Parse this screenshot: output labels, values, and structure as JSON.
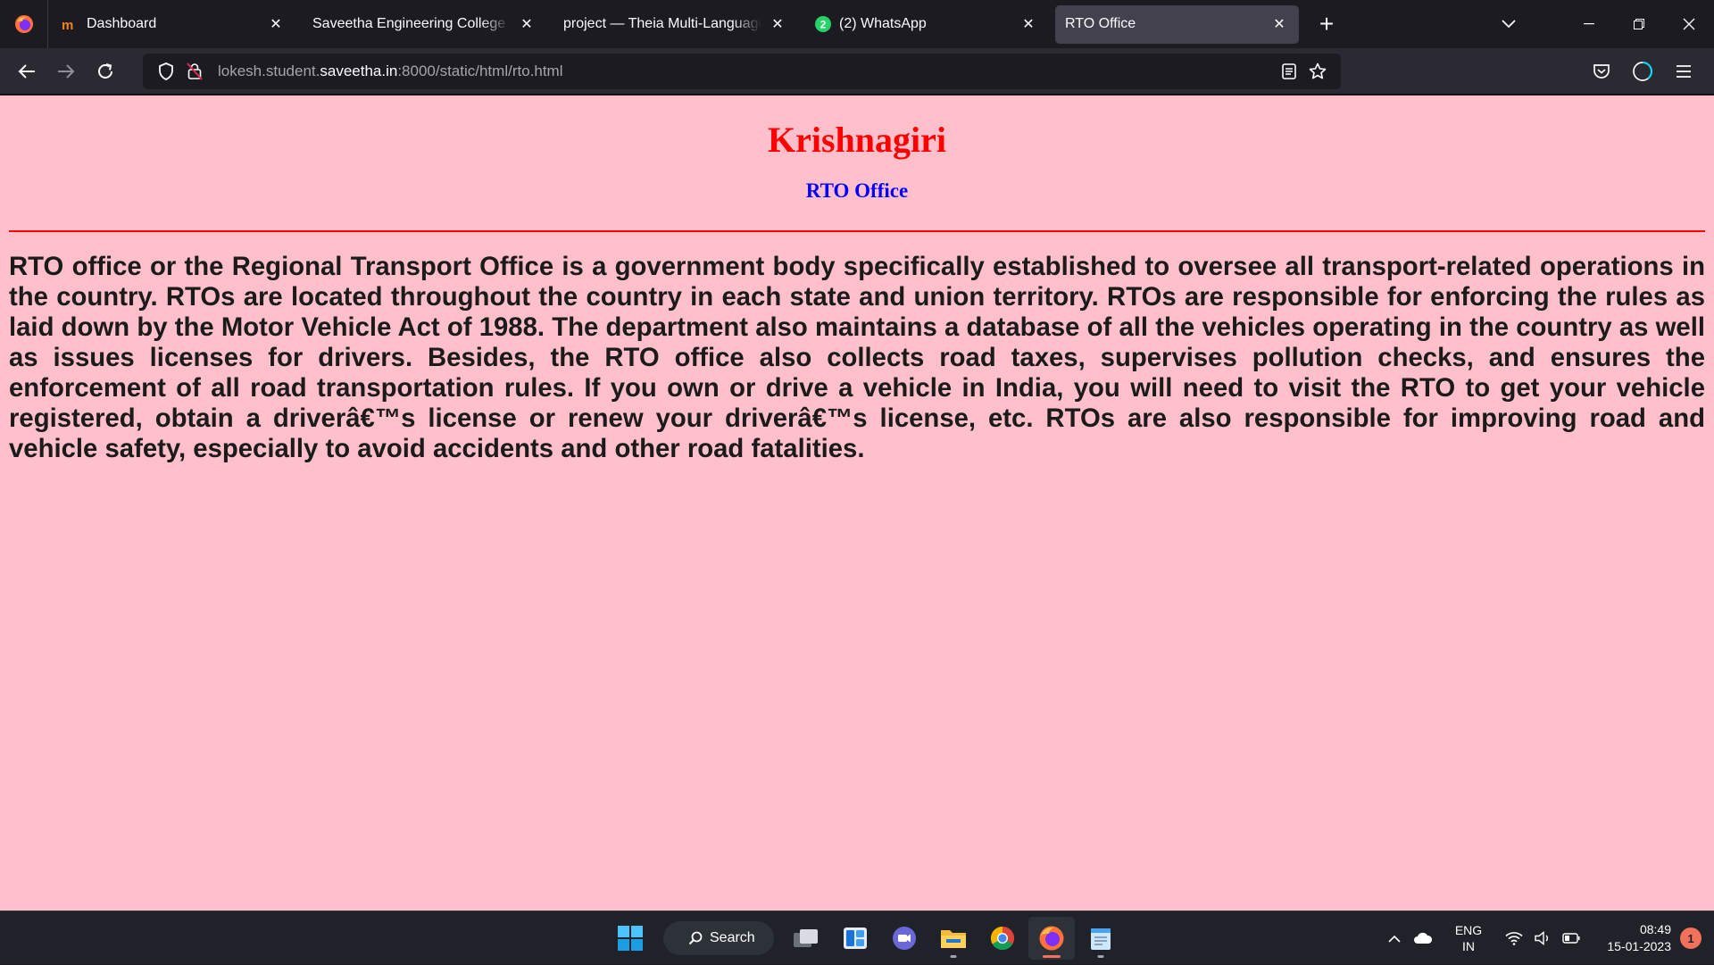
{
  "browser": {
    "tabs": [
      {
        "title": "Dashboard",
        "favicon": "moodle-icon",
        "active": false
      },
      {
        "title": "Saveetha Engineering College",
        "favicon": "none",
        "active": false
      },
      {
        "title": "project — Theia Multi-Language Explorer",
        "favicon": "none",
        "active": false
      },
      {
        "title": "(2) WhatsApp",
        "favicon": "whatsapp-icon",
        "badge": "2",
        "active": false
      },
      {
        "title": "RTO Office",
        "favicon": "none",
        "active": true
      }
    ],
    "close_glyph": "✕",
    "new_tab_glyph": "+",
    "url": {
      "prefix": "lokesh.student.",
      "domain": "saveetha.in",
      "suffix": ":8000/static/html/rto.html"
    }
  },
  "page": {
    "heading": "Krishnagiri",
    "subheading": "RTO Office",
    "paragraph": "RTO office or the Regional Transport Office is a government body specifically established to oversee all transport-related operations in the country. RTOs are located throughout the country in each state and union territory. RTOs are responsible for enforcing the rules as laid down by the Motor Vehicle Act of 1988. The department also maintains a database of all the vehicles operating in the country as well as issues licenses for drivers. Besides, the RTO office also collects road taxes, supervises pollution checks, and ensures the enforcement of all road transportation rules. If you own or drive a vehicle in India, you will need to visit the RTO to get your vehicle registered, obtain a driverâ€™s license or renew your driverâ€™s license, etc. RTOs are also responsible for improving road and vehicle safety, especially to avoid accidents and other road fatalities.",
    "colors": {
      "background": "#ffc0cb",
      "heading": "#ff0000",
      "subheading": "#0000ff",
      "rule": "#ff0000"
    }
  },
  "taskbar": {
    "search_label": "Search",
    "apps": [
      "task-view-icon",
      "widgets-icon",
      "teams-chat-icon",
      "file-explorer-icon",
      "chrome-icon",
      "firefox-icon",
      "notepad-icon"
    ],
    "language_line1": "ENG",
    "language_line2": "IN",
    "time": "08:49",
    "date": "15-01-2023",
    "notification_count": "1"
  }
}
